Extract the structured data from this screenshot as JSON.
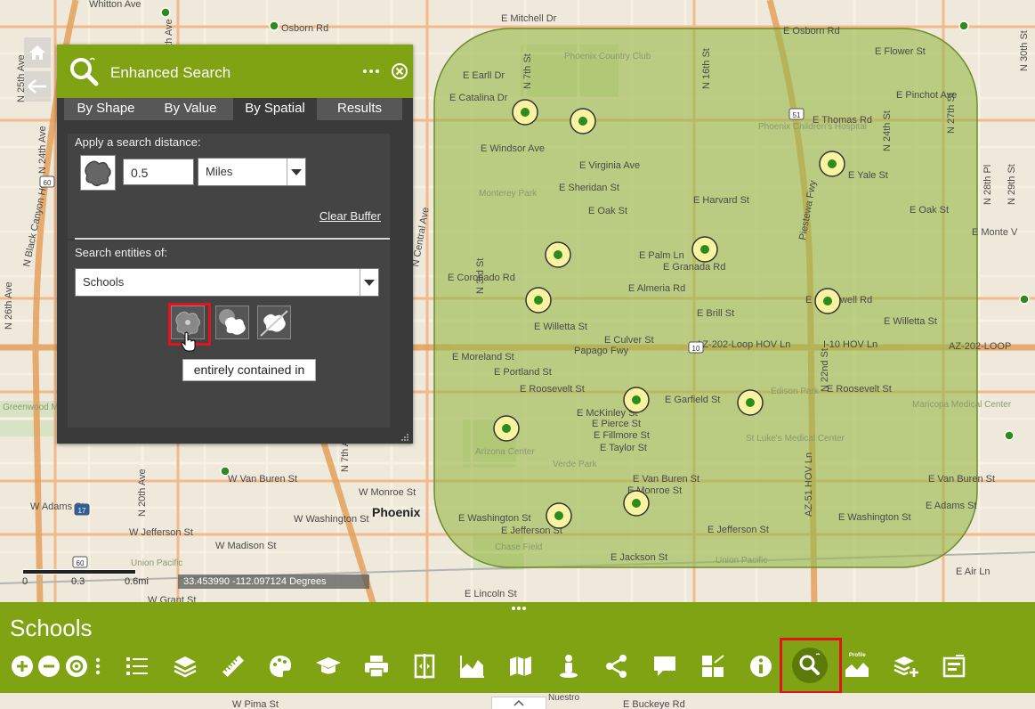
{
  "map": {
    "city_label": "Phoenix",
    "streets": {
      "whitton": "Whitton Ave",
      "osborn_w": "Osborn Rd",
      "mitchell": "E Mitchell Dr",
      "osborn_e": "E Osborn Rd",
      "flower": "E Flower St",
      "earll": "E Earll Dr",
      "catalina": "E Catalina Dr",
      "pinchot": "E Pinchot Ave",
      "thomas": "E Thomas Rd",
      "windsor": "E Windsor Ave",
      "virginia": "E Virginia Ave",
      "yale": "E Yale St",
      "sheridan": "E Sheridan St",
      "harvard": "E Harvard St",
      "oak": "E Oak St",
      "oak_e": "E Oak St",
      "monte_vista": "E Monte V",
      "palm": "E Palm Ln",
      "granada": "E Granada Rd",
      "coronado": "E Coronado Rd",
      "almeria": "E Almeria Rd",
      "mcdowell": "E McDowell Rd",
      "brill": "E Brill St",
      "willetta": "E Willetta St",
      "willetta_e": "E Willetta St",
      "culver": "E Culver St",
      "papago": "Papago Fwy",
      "loop202": "AZ-202-Loop HOV Ln",
      "i10hov": "I-10 HOV Ln",
      "loop202_e": "AZ-202-LOOP",
      "moreland": "E Moreland St",
      "portland": "E Portland St",
      "roosevelt": "E Roosevelt St",
      "roosevelt_e": "E Roosevelt St",
      "garfield": "E Garfield St",
      "mckinley": "E McKinley St",
      "pierce": "E Pierce St",
      "fillmore": "E Fillmore St",
      "taylor": "E Taylor St",
      "van_buren": "E Van Buren St",
      "van_buren_e": "E Van Buren St",
      "van_buren_w": "W Van Buren St",
      "monroe_w": "W Monroe St",
      "monroe_e": "E Monroe St",
      "adams_w": "W Adams St",
      "adams_e": "E Adams St",
      "washington_w": "W Washington St",
      "washington_e": "E Washington St",
      "washington_e2": "E Washington St",
      "jefferson_w": "W Jefferson St",
      "jefferson_e": "E Jefferson St",
      "jefferson_e2": "E Jefferson St",
      "madison": "W Madison St",
      "jackson": "E Jackson St",
      "lincoln": "E Lincoln St",
      "grant": "W Grant St",
      "pima": "W Pima St",
      "buckeye": "E Buckeye Rd",
      "air": "E Air Ln",
      "piestewa": "Piestewa Fwy",
      "az51": "AZ-51 HOV Ln",
      "n16": "N 16th St",
      "n7": "N 7th St",
      "n3": "N 3rd St",
      "n24": "N 24th St",
      "n22": "N 22nd St",
      "n27": "N 27th St",
      "n28pl": "N 28th Pl",
      "n29": "N 29th St",
      "n30": "N 30th St",
      "central": "N Central Ave",
      "n7ave": "N 7th Ave",
      "n19ave": "N 19th Ave",
      "n20ave": "N 20th Ave",
      "n24ave": "N 24th Ave",
      "n25ave": "N 25th Ave",
      "n26ave": "N 26th Ave",
      "black_canyon": "N Black Canyon Hwy"
    },
    "places": {
      "phoenix_cc": "Phoenix Country Club",
      "monterey": "Monterey Park",
      "childrens": "Phoenix Children's Hospital",
      "edison": "Edison Park",
      "maricopa": "Maricopa Medical Center",
      "st_lukes": "St Luke's Medical Center",
      "arizona": "Arizona Center",
      "verde": "Verde Park",
      "chase": "Chase Field",
      "greenwood": "Greenwood Memory Lawn Cemetery",
      "union_pacific": "Union Pacific",
      "union_pacific2": "Union Pacific",
      "nuestro": "Nuestro"
    }
  },
  "side_nav": {
    "home_icon": "home-icon",
    "back_icon": "back-arrow-icon"
  },
  "panel": {
    "title": "Enhanced Search",
    "tabs": [
      "By Shape",
      "By Value",
      "By Spatial",
      "Results"
    ],
    "active_tab": "By Spatial",
    "distance_label": "Apply a search distance:",
    "distance_value": "0.5",
    "unit_value": "Miles",
    "clear_buffer": "Clear Buffer",
    "entities_label": "Search entities of:",
    "entities_value": "Schools",
    "tooltip": "entirely contained in",
    "spatial_ops": [
      "entirely contained in",
      "intersected by",
      "touching"
    ]
  },
  "scale": {
    "labels": [
      "0",
      "0.3",
      "0.6mi"
    ]
  },
  "coordinates": "33.453990 -112.097124 Degrees",
  "toolbar": {
    "title": "Schools",
    "tools": [
      "zoom-in-icon",
      "zoom-out-icon",
      "locate-icon",
      "more-vert-icon",
      "legend-icon",
      "layers-icon",
      "measure-icon",
      "basemap-icon",
      "education-icon",
      "print-icon",
      "swipe-icon",
      "chart-icon",
      "map-chat-icon",
      "street-view-icon",
      "share-icon",
      "comment-icon",
      "widget-grid-icon",
      "info-icon",
      "enhanced-search-icon",
      "profile-icon",
      "add-layer-icon",
      "situation-icon"
    ],
    "profile_label": "Profile"
  },
  "colors": {
    "brand_green": "#7fa313",
    "buffer_fill": "#9ab84a",
    "highlight_red": "#e0141e",
    "panel_bg": "#3a3a3a"
  }
}
